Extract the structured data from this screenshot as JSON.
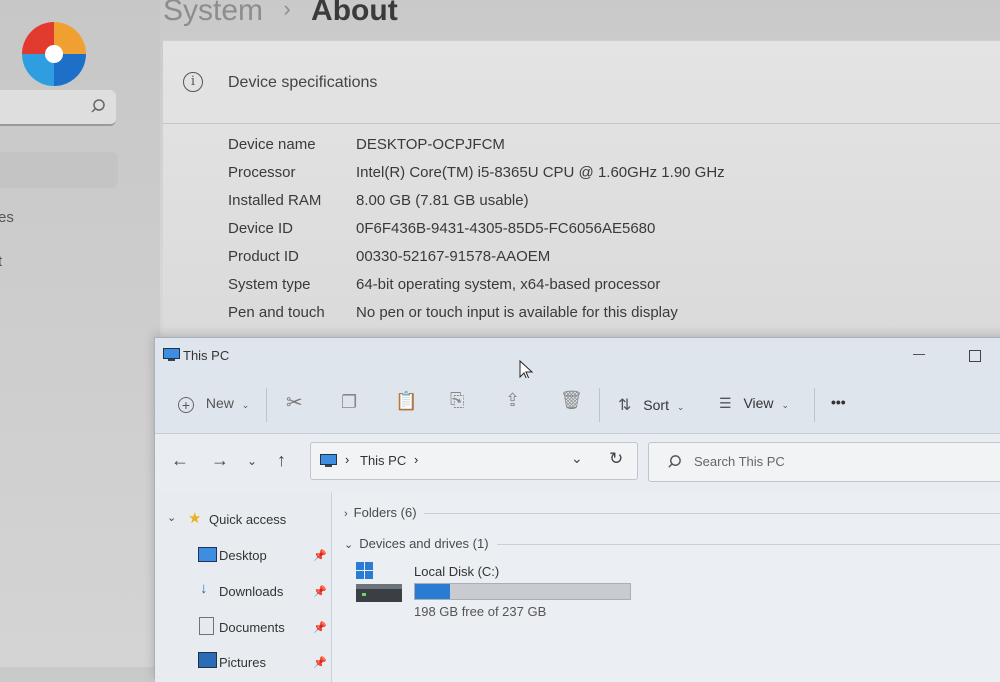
{
  "settings": {
    "breadcrumb_parent": "System",
    "breadcrumb_sep": "›",
    "breadcrumb_current": "About",
    "left_items": [
      "es",
      "t"
    ],
    "spec_title": "Device specifications",
    "specs": [
      {
        "label": "Device name",
        "value": "DESKTOP-OCPJFCM"
      },
      {
        "label": "Processor",
        "value": "Intel(R) Core(TM) i5-8365U CPU @ 1.60GHz   1.90 GHz"
      },
      {
        "label": "Installed RAM",
        "value": "8.00 GB (7.81 GB usable)"
      },
      {
        "label": "Device ID",
        "value": "0F6F436B-9431-4305-85D5-FC6056AE5680"
      },
      {
        "label": "Product ID",
        "value": "00330-52167-91578-AAOEM"
      },
      {
        "label": "System type",
        "value": "64-bit operating system, x64-based processor"
      },
      {
        "label": "Pen and touch",
        "value": "No pen or touch input is available for this display"
      }
    ]
  },
  "explorer": {
    "title": "This PC",
    "toolbar": {
      "new": "New",
      "sort": "Sort",
      "view": "View",
      "more": "•••"
    },
    "address": {
      "location": "This PC",
      "sep": "›"
    },
    "search_placeholder": "Search This PC",
    "nav": {
      "quick_access": "Quick access",
      "items": [
        "Desktop",
        "Downloads",
        "Documents",
        "Pictures"
      ]
    },
    "groups": {
      "folders": "Folders (6)",
      "devices": "Devices and drives (1)"
    },
    "drive": {
      "name": "Local Disk (C:)",
      "free_text": "198 GB free of 237 GB",
      "used_fraction": 0.165
    },
    "colors": {
      "accent": "#2a7bd4",
      "star": "#e8b21c"
    }
  }
}
